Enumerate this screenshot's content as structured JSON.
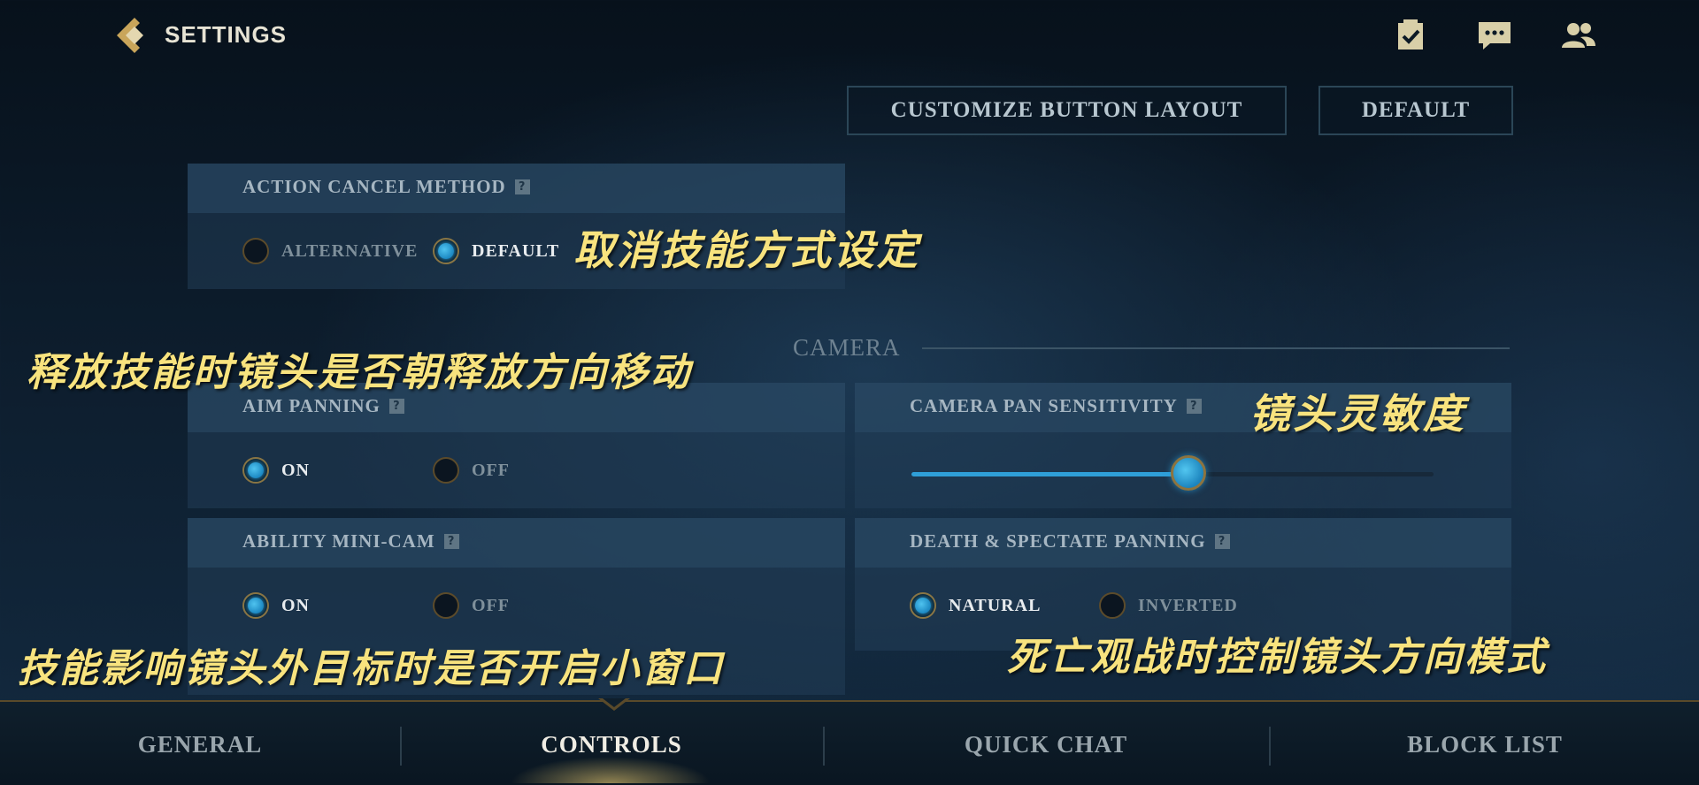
{
  "header": {
    "title": "SETTINGS",
    "icons": [
      "checklist-icon",
      "chat-icon",
      "friends-icon"
    ]
  },
  "actions": {
    "customize_label": "CUSTOMIZE BUTTON LAYOUT",
    "default_label": "DEFAULT"
  },
  "settings": {
    "action_cancel": {
      "label": "ACTION CANCEL METHOD",
      "help": "?",
      "options": [
        "ALTERNATIVE",
        "DEFAULT"
      ],
      "selected": "DEFAULT"
    },
    "camera_section": "CAMERA",
    "aim_panning": {
      "label": "AIM PANNING",
      "help": "?",
      "options": [
        "ON",
        "OFF"
      ],
      "selected": "ON"
    },
    "camera_pan_sensitivity": {
      "label": "CAMERA PAN SENSITIVITY",
      "help": "?",
      "value_fraction": 0.53
    },
    "ability_minicam": {
      "label": "ABILITY MINI-CAM",
      "help": "?",
      "options": [
        "ON",
        "OFF"
      ],
      "selected": "ON"
    },
    "death_spectate": {
      "label": "DEATH & SPECTATE PANNING",
      "help": "?",
      "options": [
        "NATURAL",
        "INVERTED"
      ],
      "selected": "NATURAL"
    }
  },
  "captions": {
    "action_cancel": "取消技能方式设定",
    "aim_panning": "释放技能时镜头是否朝释放方向移动",
    "sensitivity": "镜头灵敏度",
    "minicam": "技能影响镜头外目标时是否开启小窗口",
    "death_spectate": "死亡观战时控制镜头方向模式"
  },
  "tabs": [
    {
      "label": "GENERAL"
    },
    {
      "label": "CONTROLS"
    },
    {
      "label": "QUICK CHAT"
    },
    {
      "label": "BLOCK LIST"
    }
  ],
  "active_tab": "CONTROLS",
  "colors": {
    "accent_blue": "#2f9fd8",
    "gold_border": "#8c7440",
    "caption_yellow": "#f8e37e"
  }
}
